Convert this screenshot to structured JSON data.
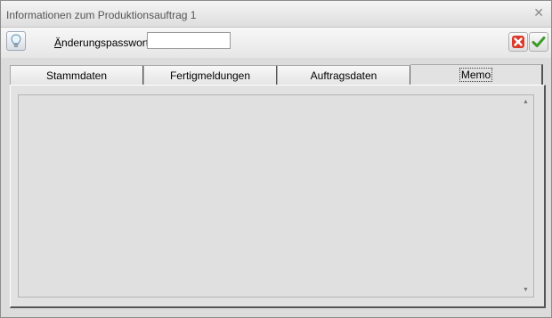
{
  "window": {
    "title": "Informationen zum Produktionsauftrag 1"
  },
  "toolbar": {
    "password_label_accel": "Ä",
    "password_label_rest": "nderungspasswort",
    "password_value": "",
    "colors": {
      "cancel": "#d93a2b",
      "ok": "#3c9b2b"
    }
  },
  "tabs": [
    {
      "label": "Stammdaten",
      "active": false
    },
    {
      "label": "Fertigmeldungen",
      "active": false
    },
    {
      "label": "Auftragsdaten",
      "active": false
    },
    {
      "label": "Memo",
      "active": true
    }
  ],
  "memo": {
    "text": ""
  },
  "icons": {
    "close": "close-icon",
    "hint": "lightbulb-icon",
    "cancel": "cancel-icon",
    "ok": "checkmark-icon",
    "scroll_up": "scroll-up-arrow-icon",
    "scroll_down": "scroll-down-arrow-icon"
  }
}
